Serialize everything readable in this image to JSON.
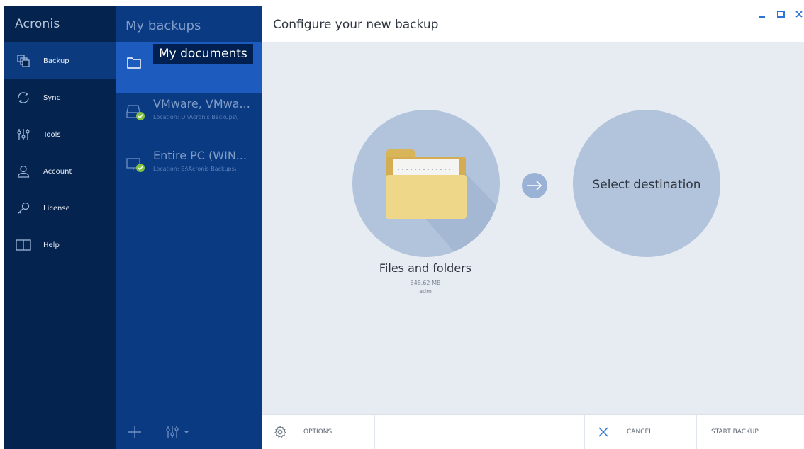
{
  "app": {
    "logo": "Acronis"
  },
  "sidebar": {
    "items": [
      {
        "label": "Backup",
        "icon": "backup-copies-icon",
        "active": true
      },
      {
        "label": "Sync",
        "icon": "sync-icon"
      },
      {
        "label": "Tools",
        "icon": "tools-sliders-icon"
      },
      {
        "label": "Account",
        "icon": "account-person-icon"
      },
      {
        "label": "License",
        "icon": "license-key-icon"
      },
      {
        "label": "Help",
        "icon": "help-book-icon"
      }
    ]
  },
  "backups": {
    "title": "My backups",
    "items": [
      {
        "name": "My documents",
        "location": "",
        "selected": true
      },
      {
        "name": "VMware, VMwa...",
        "location": "Location: D:\\Acronis Backups\\"
      },
      {
        "name": "Entire PC (WIN...",
        "location": "Location: E:\\Acronis Backups\\"
      }
    ],
    "tooltip": "My documents"
  },
  "main": {
    "title": "Configure your new backup",
    "source": {
      "label": "Files and folders",
      "size": "648.62 MB",
      "user": "adm"
    },
    "destination": {
      "label": "Select destination"
    }
  },
  "footer": {
    "options": "OPTIONS",
    "cancel": "CANCEL",
    "start": "START BACKUP"
  },
  "colors": {
    "sidebar": "#05234f",
    "list_panel": "#0a3a82",
    "selected": "#1e5bbf",
    "circle": "#b2c4dc",
    "accent": "#2c74d6"
  }
}
